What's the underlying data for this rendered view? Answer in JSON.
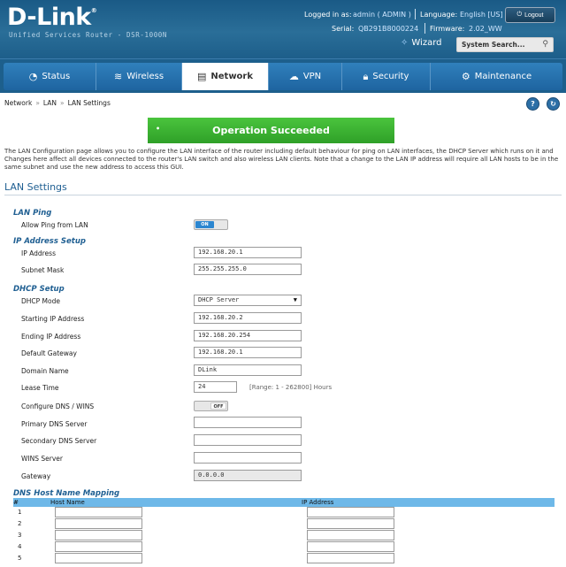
{
  "header": {
    "brand": "D-Link",
    "product": "Unified Services Router - DSR-1000N",
    "logged_label": "Logged in as:",
    "logged_value": "admin ( ADMIN )",
    "language_label": "Language:",
    "language_value": "English [US]",
    "logout": "Logout",
    "serial_label": "Serial:",
    "serial_value": "QB291B8000224",
    "firmware_label": "Firmware:",
    "firmware_value": "2.02_WW",
    "wizard": "Wizard",
    "search_placeholder": "System Search..."
  },
  "nav": {
    "items": [
      {
        "label": "Status",
        "icon": "gauge-icon"
      },
      {
        "label": "Wireless",
        "icon": "wifi-icon"
      },
      {
        "label": "Network",
        "icon": "network-icon",
        "active": true
      },
      {
        "label": "VPN",
        "icon": "cloud-icon"
      },
      {
        "label": "Security",
        "icon": "lock-icon"
      },
      {
        "label": "Maintenance",
        "icon": "gear-icon"
      }
    ]
  },
  "breadcrumb": [
    "Network",
    "LAN",
    "LAN Settings"
  ],
  "banner": "Operation Succeeded",
  "description": "The LAN Configuration page allows you to configure the LAN interface of the router including default behaviour for ping on LAN interfaces, the DHCP Server which runs on it and Changes here affect all devices connected to the router's LAN switch and also wireless LAN clients. Note that a change to the LAN IP address will require all LAN hosts to be in the same subnet and use the new address to access this GUI.",
  "section_title": "LAN Settings",
  "lan_ping": {
    "heading": "LAN Ping",
    "allow_label": "Allow Ping from LAN",
    "on_text": "ON"
  },
  "ip_setup": {
    "heading": "IP Address Setup",
    "ip_label": "IP Address",
    "ip_value": "192.168.20.1",
    "mask_label": "Subnet Mask",
    "mask_value": "255.255.255.0"
  },
  "dhcp": {
    "heading": "DHCP Setup",
    "mode_label": "DHCP Mode",
    "mode_value": "DHCP Server",
    "start_label": "Starting IP Address",
    "start_value": "192.168.20.2",
    "end_label": "Ending IP Address",
    "end_value": "192.168.20.254",
    "gw_label": "Default Gateway",
    "gw_value": "192.168.20.1",
    "domain_label": "Domain Name",
    "domain_value": "DLink",
    "lease_label": "Lease Time",
    "lease_value": "24",
    "lease_hint": "[Range: 1 - 262800] Hours",
    "dns_wins_label": "Configure DNS / WINS",
    "off_text": "OFF",
    "primary_dns_label": "Primary DNS Server",
    "primary_dns_value": "",
    "secondary_dns_label": "Secondary DNS Server",
    "secondary_dns_value": "",
    "wins_label": "WINS Server",
    "wins_value": "",
    "gateway_label": "Gateway",
    "gateway_value": "0.0.0.0"
  },
  "dns_mapping": {
    "heading": "DNS Host Name Mapping",
    "col_num": "#",
    "col_host": "Host Name",
    "col_ip": "IP Address",
    "rows": [
      "1",
      "2",
      "3",
      "4",
      "5"
    ]
  }
}
